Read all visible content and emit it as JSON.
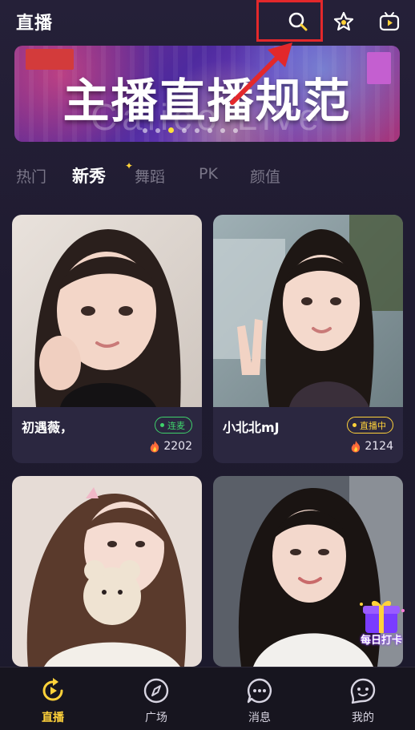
{
  "header": {
    "title": "直播",
    "icons": [
      "search-icon",
      "star-icon",
      "tv-icon"
    ],
    "highlight_color": "#e3282b"
  },
  "banner": {
    "title": "主播直播规范",
    "watermark": "Calico Live",
    "dot_count": 8,
    "active_dot": 2
  },
  "tabs": [
    {
      "label": "热门",
      "active": false
    },
    {
      "label": "新秀",
      "active": true
    },
    {
      "label": "舞蹈",
      "active": false
    },
    {
      "label": "PK",
      "active": false
    },
    {
      "label": "颜值",
      "active": false
    }
  ],
  "cards": [
    {
      "name": "初遇薇，",
      "badge": "连麦",
      "badge_color": "green",
      "heat": "2202"
    },
    {
      "name": "小北北mJ",
      "badge": "直播中",
      "badge_color": "yellow",
      "heat": "2124"
    },
    {
      "name": "",
      "badge": "",
      "heat": ""
    },
    {
      "name": "",
      "badge": "",
      "heat": ""
    }
  ],
  "checkin": {
    "label": "每日打卡"
  },
  "tabbar": [
    {
      "label": "直播",
      "icon": "live-icon",
      "active": true
    },
    {
      "label": "广场",
      "icon": "compass-icon",
      "active": false
    },
    {
      "label": "消息",
      "icon": "chat-icon",
      "active": false
    },
    {
      "label": "我的",
      "icon": "profile-icon",
      "active": false
    }
  ],
  "colors": {
    "accent": "#ffd23a",
    "live_green": "#3fd26b",
    "background": "#1f1b30"
  }
}
